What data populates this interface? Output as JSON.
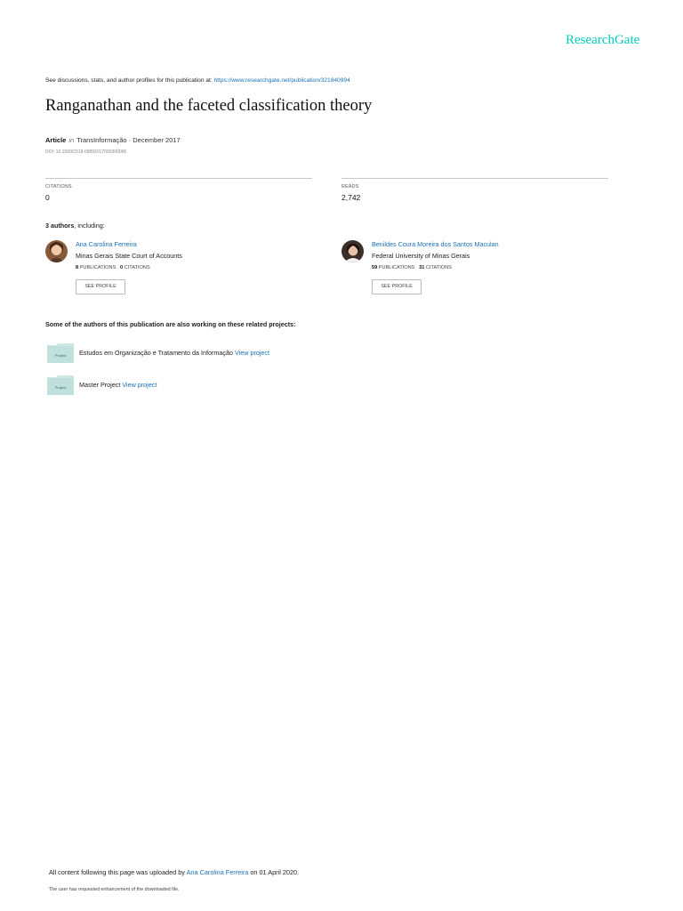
{
  "brand": {
    "logo": "ResearchGate",
    "color": "#00ccbb",
    "link_color": "#1a6fb5"
  },
  "discussion": {
    "prefix": "See discussions, stats, and author profiles for this publication at: ",
    "url": "https://www.researchgate.net/publication/321840994"
  },
  "publication": {
    "title": "Ranganathan and the faceted classification theory",
    "type": "Article",
    "in_word": "in",
    "venue_date": "TransInformação · December 2017",
    "doi": "DOI: 10.1590/2318-08892017000300006"
  },
  "stats": {
    "citations_label": "CITATIONS",
    "citations_value": "0",
    "reads_label": "READS",
    "reads_value": "2,742"
  },
  "authors_header": {
    "count": "3 authors",
    "suffix": ", including:"
  },
  "authors": [
    {
      "name": "Ana Carolina Ferreira",
      "institution": "Minas Gerais State Court of Accounts",
      "publications_count": "8",
      "publications_label": "PUBLICATIONS",
      "citations_count": "0",
      "citations_label": "CITATIONS",
      "button": "SEE PROFILE"
    },
    {
      "name": "Benildes Coura Moreira dos Santos Maculan",
      "institution": "Federal University of Minas Gerais",
      "publications_count": "59",
      "publications_label": "PUBLICATIONS",
      "citations_count": "31",
      "citations_label": "CITATIONS",
      "button": "SEE PROFILE"
    }
  ],
  "projects_header": "Some of the authors of this publication are also working on these related projects:",
  "projects": [
    {
      "icon_label": "Project",
      "name": "Estudos em Organização e Tratamento da Informação ",
      "link": "View project"
    },
    {
      "icon_label": "Project",
      "name": "Master Project ",
      "link": "View project"
    }
  ],
  "footer": {
    "uploaded_prefix": "All content following this page was uploaded by ",
    "uploader": "Ana Carolina Ferreira",
    "uploaded_suffix": " on 01 April 2020.",
    "note": "The user has requested enhancement of the downloaded file."
  }
}
